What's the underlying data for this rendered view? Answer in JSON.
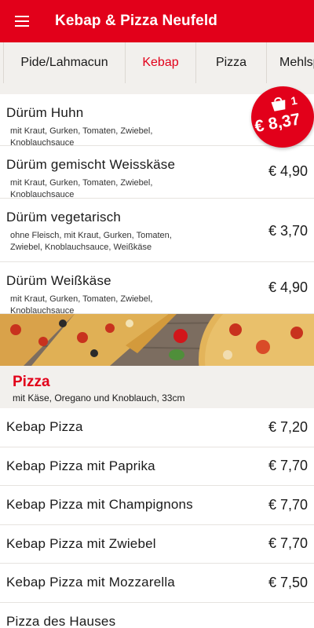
{
  "app": {
    "title": "Kebap & Pizza Neufeld"
  },
  "tabs": [
    "Pide/Lahmacun",
    "Kebap",
    "Pizza",
    "Mehlsp"
  ],
  "active_tab": "Kebap",
  "kebap_items": [
    {
      "name": "Dürüm Huhn",
      "desc": "mit Kraut, Gurken, Tomaten, Zwiebel, Knoblauchsauce",
      "price": ""
    },
    {
      "name": "Dürüm gemischt Weisskäse",
      "desc": "mit Kraut, Gurken, Tomaten, Zwiebel, Knoblauchsauce",
      "price": "€ 4,90"
    },
    {
      "name": "Dürüm vegetarisch",
      "desc": "ohne Fleisch, mit Kraut, Gurken, Tomaten, Zwiebel, Knoblauchsauce, Weißkäse",
      "price": "€ 3,70"
    },
    {
      "name": "Dürüm Weißkäse",
      "desc": "mit Kraut, Gurken, Tomaten, Zwiebel, Knoblauchsauce",
      "price": "€ 4,90"
    }
  ],
  "pizza_section": {
    "title": "Pizza",
    "subtitle": "mit Käse, Oregano und Knoblauch, 33cm"
  },
  "pizza_items": [
    {
      "name": "Kebap Pizza",
      "price": "€ 7,20"
    },
    {
      "name": "Kebap Pizza mit Paprika",
      "price": "€ 7,70"
    },
    {
      "name": "Kebap Pizza mit Champignons",
      "price": "€ 7,70"
    },
    {
      "name": "Kebap Pizza mit Zwiebel",
      "price": "€ 7,70"
    },
    {
      "name": "Kebap Pizza mit Mozzarella",
      "price": "€ 7,50"
    },
    {
      "name": "Pizza des Hauses",
      "price": ""
    }
  ],
  "cart": {
    "count": "1",
    "total": "€ 8,37",
    "icon": "shopping-bag-icon"
  },
  "colors": {
    "brand": "#e2001a",
    "tabs_bg": "#f2f0ed",
    "divider": "#e6e3df"
  }
}
